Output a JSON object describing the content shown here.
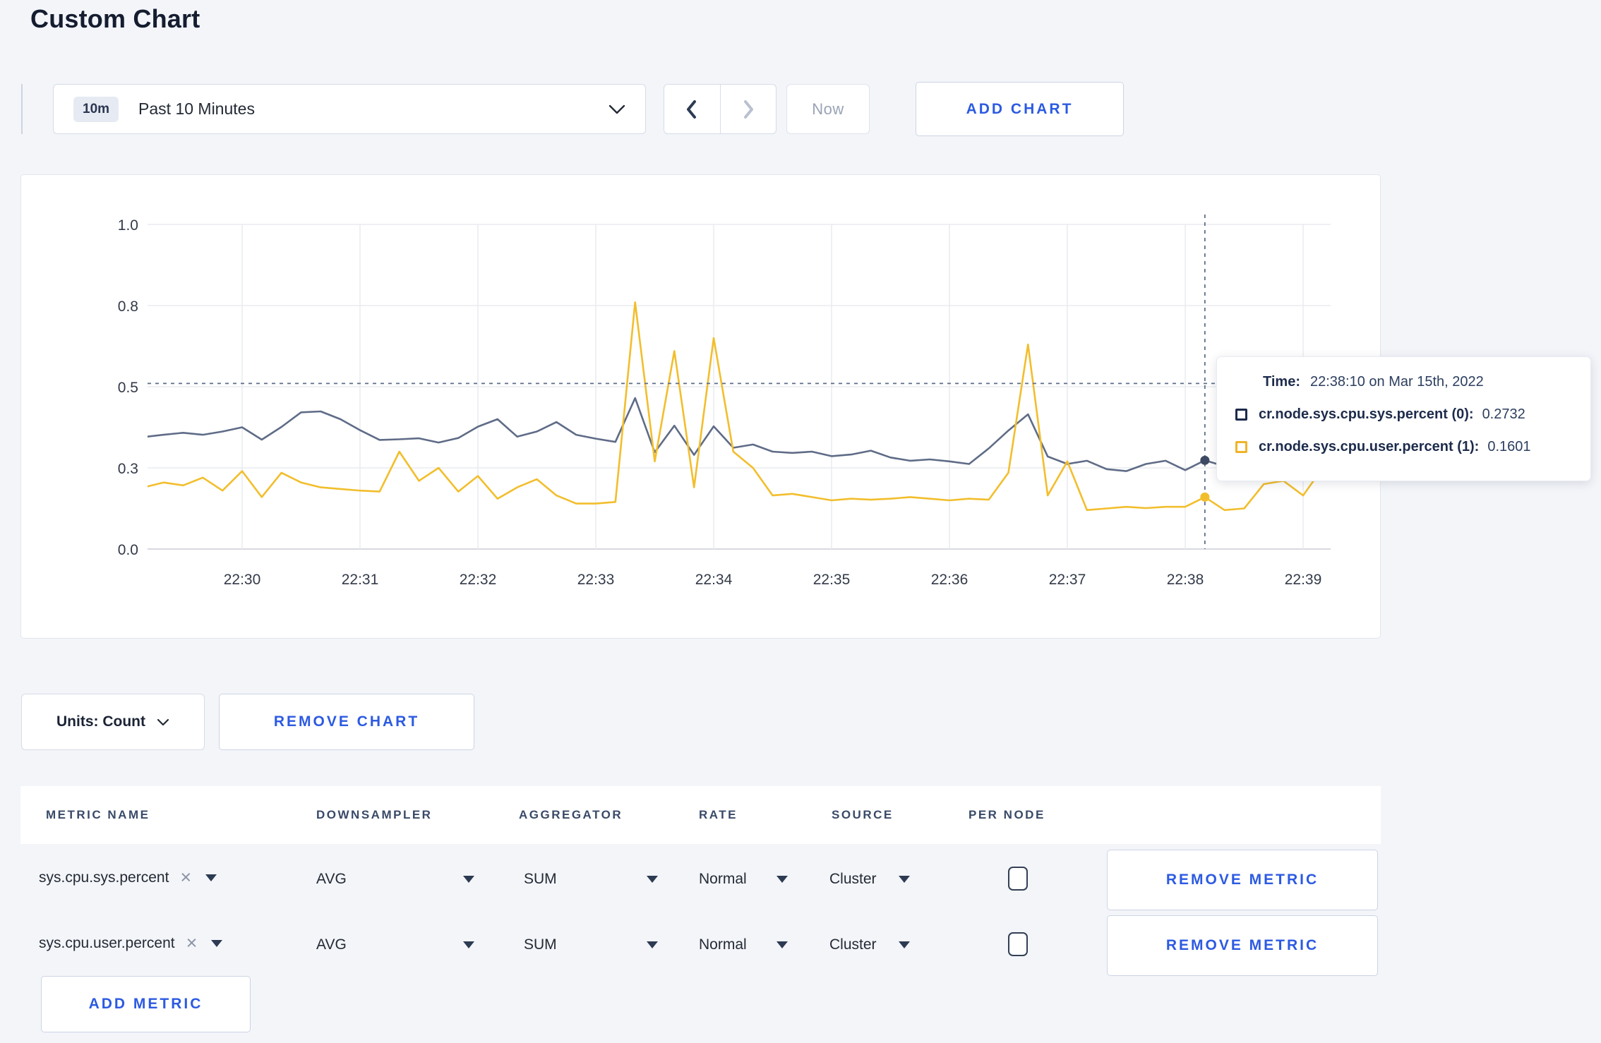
{
  "page": {
    "title": "Custom Chart"
  },
  "toolbar": {
    "range_badge": "10m",
    "range_label": "Past 10 Minutes",
    "prev_label": "previous time window",
    "next_label": "next time window",
    "now_label": "Now",
    "add_chart_label": "ADD CHART"
  },
  "chart_data": {
    "type": "line",
    "title": "",
    "xlabel": "",
    "ylabel": "",
    "ylim": [
      0,
      1
    ],
    "grid": true,
    "y_tick_labels": [
      "1.0",
      "0.8",
      "0.5",
      "0.3",
      "0.0"
    ],
    "y_tick_values": [
      1,
      0.75,
      0.5,
      0.25,
      0
    ],
    "x_ticks": [
      "22:30",
      "22:31",
      "22:32",
      "22:33",
      "22:34",
      "22:35",
      "22:36",
      "22:37",
      "22:38",
      "22:39"
    ],
    "start_time": "22:29:10",
    "interval_seconds": 10,
    "series": [
      {
        "name": "cr.node.sys.cpu.sys.percent",
        "color": "#5f6c87",
        "dot_color": "#3d4a63",
        "values": [
          0.345,
          0.352,
          0.358,
          0.352,
          0.362,
          0.375,
          0.337,
          0.376,
          0.421,
          0.424,
          0.4,
          0.366,
          0.336,
          0.338,
          0.341,
          0.328,
          0.342,
          0.377,
          0.4,
          0.346,
          0.362,
          0.391,
          0.352,
          0.34,
          0.33,
          0.465,
          0.298,
          0.38,
          0.29,
          0.378,
          0.312,
          0.322,
          0.3,
          0.296,
          0.3,
          0.286,
          0.291,
          0.303,
          0.282,
          0.272,
          0.276,
          0.27,
          0.262,
          0.31,
          0.365,
          0.415,
          0.285,
          0.262,
          0.272,
          0.246,
          0.24,
          0.262,
          0.272,
          0.243,
          0.2732,
          0.255,
          0.28,
          0.3,
          0.295,
          0.3,
          0.3
        ]
      },
      {
        "name": "cr.node.sys.cpu.user.percent",
        "color": "#f2be2c",
        "dot_color": "#f2be2c",
        "values": [
          0.19,
          0.205,
          0.196,
          0.22,
          0.18,
          0.24,
          0.16,
          0.235,
          0.205,
          0.19,
          0.185,
          0.18,
          0.177,
          0.3,
          0.21,
          0.25,
          0.177,
          0.225,
          0.155,
          0.19,
          0.215,
          0.165,
          0.14,
          0.14,
          0.145,
          0.76,
          0.27,
          0.61,
          0.19,
          0.65,
          0.3,
          0.25,
          0.165,
          0.17,
          0.16,
          0.15,
          0.155,
          0.152,
          0.155,
          0.16,
          0.155,
          0.15,
          0.155,
          0.152,
          0.235,
          0.63,
          0.165,
          0.27,
          0.12,
          0.125,
          0.13,
          0.126,
          0.13,
          0.13,
          0.1601,
          0.12,
          0.125,
          0.2,
          0.21,
          0.165,
          0.25
        ]
      }
    ],
    "crosshair": {
      "x_offset_minutes": 8.1667,
      "y_value": 0.51,
      "marker_index": 54,
      "time": "22:38:10"
    },
    "legend_position": "tooltip"
  },
  "tooltip": {
    "time_label": "Time:",
    "time_value": "22:38:10 on Mar 15th, 2022",
    "rows": [
      {
        "label": "cr.node.sys.cpu.sys.percent (0):",
        "value": "0.2732",
        "color": "#1c2b4a"
      },
      {
        "label": "cr.node.sys.cpu.user.percent (1):",
        "value": "0.1601",
        "color": "#f0b429"
      }
    ]
  },
  "chart_footer": {
    "units_label": "Units: Count",
    "remove_chart_label": "REMOVE CHART"
  },
  "metrics_table": {
    "headers": {
      "metric_name": "METRIC NAME",
      "downsampler": "DOWNSAMPLER",
      "aggregator": "AGGREGATOR",
      "rate": "RATE",
      "source": "SOURCE",
      "per_node": "PER NODE"
    },
    "rows": [
      {
        "metric": "sys.cpu.sys.percent",
        "downsampler": "AVG",
        "aggregator": "SUM",
        "rate": "Normal",
        "source": "Cluster",
        "per_node_checked": false,
        "remove_label": "REMOVE METRIC"
      },
      {
        "metric": "sys.cpu.user.percent",
        "downsampler": "AVG",
        "aggregator": "SUM",
        "rate": "Normal",
        "source": "Cluster",
        "per_node_checked": false,
        "remove_label": "REMOVE METRIC"
      }
    ],
    "add_metric_label": "ADD METRIC"
  }
}
